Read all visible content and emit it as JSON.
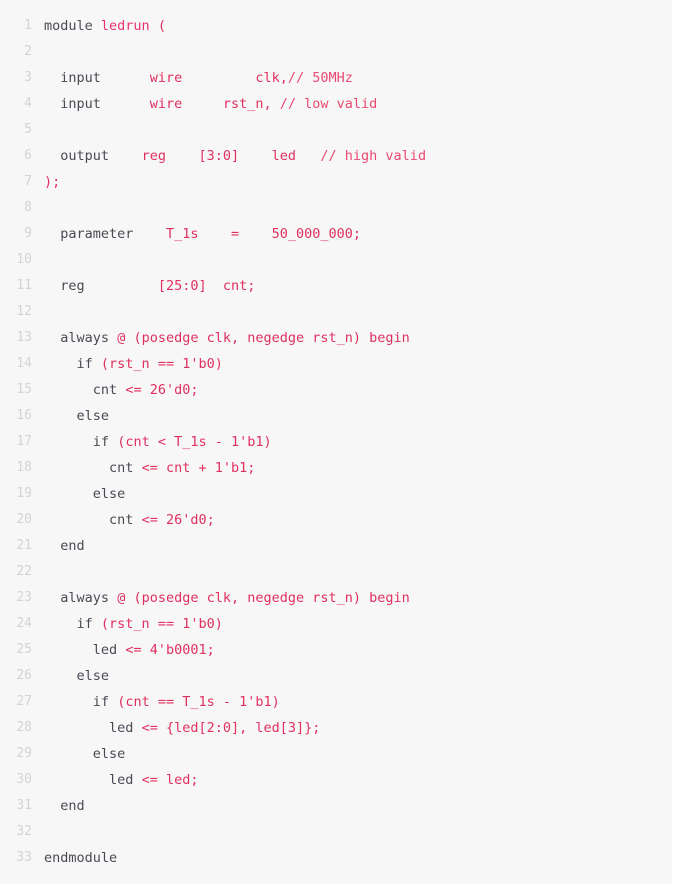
{
  "editor": {
    "language": "verilog",
    "module_name": "ledrun",
    "total_lines": 33,
    "background_color": "#f7f7f7",
    "keyword_color": "#4a4a55",
    "identifier_color": "#e03060",
    "comment_color": "#ea4a72",
    "line_number_color": "#d3d3d8"
  },
  "lines": [
    {
      "number": "1",
      "tokens": [
        {
          "t": "module",
          "c": "kw"
        },
        {
          "t": " ",
          "c": "pl"
        },
        {
          "t": "ledrun",
          "c": "def"
        },
        {
          "t": " ",
          "c": "pl"
        },
        {
          "t": "(",
          "c": "op"
        }
      ]
    },
    {
      "number": "2",
      "tokens": []
    },
    {
      "number": "3",
      "tokens": [
        {
          "t": "  ",
          "c": "pl"
        },
        {
          "t": "input",
          "c": "kw"
        },
        {
          "t": "      ",
          "c": "pl"
        },
        {
          "t": "wire",
          "c": "op"
        },
        {
          "t": "         ",
          "c": "pl"
        },
        {
          "t": "clk,",
          "c": "op"
        },
        {
          "t": "// 50MHz",
          "c": "com"
        }
      ]
    },
    {
      "number": "4",
      "tokens": [
        {
          "t": "  ",
          "c": "pl"
        },
        {
          "t": "input",
          "c": "kw"
        },
        {
          "t": "      ",
          "c": "pl"
        },
        {
          "t": "wire",
          "c": "op"
        },
        {
          "t": "     ",
          "c": "pl"
        },
        {
          "t": "rst_n,",
          "c": "op"
        },
        {
          "t": " ",
          "c": "pl"
        },
        {
          "t": "// low valid",
          "c": "com"
        }
      ]
    },
    {
      "number": "5",
      "tokens": []
    },
    {
      "number": "6",
      "tokens": [
        {
          "t": "  ",
          "c": "pl"
        },
        {
          "t": "output",
          "c": "kw"
        },
        {
          "t": "    ",
          "c": "pl"
        },
        {
          "t": "reg",
          "c": "op"
        },
        {
          "t": "    ",
          "c": "pl"
        },
        {
          "t": "[3:0]",
          "c": "op"
        },
        {
          "t": "    ",
          "c": "pl"
        },
        {
          "t": "led",
          "c": "op"
        },
        {
          "t": "   ",
          "c": "pl"
        },
        {
          "t": "// high valid",
          "c": "com"
        }
      ]
    },
    {
      "number": "7",
      "tokens": [
        {
          "t": ");",
          "c": "op"
        }
      ]
    },
    {
      "number": "8",
      "tokens": []
    },
    {
      "number": "9",
      "tokens": [
        {
          "t": "  ",
          "c": "pl"
        },
        {
          "t": "parameter",
          "c": "kw"
        },
        {
          "t": "    ",
          "c": "pl"
        },
        {
          "t": "T_1s",
          "c": "op"
        },
        {
          "t": "    ",
          "c": "pl"
        },
        {
          "t": "=",
          "c": "op"
        },
        {
          "t": "    ",
          "c": "pl"
        },
        {
          "t": "50_000_000;",
          "c": "num"
        }
      ]
    },
    {
      "number": "10",
      "tokens": []
    },
    {
      "number": "11",
      "tokens": [
        {
          "t": "  ",
          "c": "pl"
        },
        {
          "t": "reg",
          "c": "kw"
        },
        {
          "t": "         ",
          "c": "pl"
        },
        {
          "t": "[25:0]",
          "c": "op"
        },
        {
          "t": "  ",
          "c": "pl"
        },
        {
          "t": "cnt;",
          "c": "op"
        }
      ]
    },
    {
      "number": "12",
      "tokens": []
    },
    {
      "number": "13",
      "tokens": [
        {
          "t": "  ",
          "c": "pl"
        },
        {
          "t": "always",
          "c": "kw"
        },
        {
          "t": " ",
          "c": "pl"
        },
        {
          "t": "@ (posedge clk, negedge rst_n) begin",
          "c": "op"
        }
      ]
    },
    {
      "number": "14",
      "tokens": [
        {
          "t": "    ",
          "c": "pl"
        },
        {
          "t": "if",
          "c": "kw"
        },
        {
          "t": " ",
          "c": "pl"
        },
        {
          "t": "(rst_n == 1'b0)",
          "c": "op"
        }
      ]
    },
    {
      "number": "15",
      "tokens": [
        {
          "t": "      ",
          "c": "pl"
        },
        {
          "t": "cnt",
          "c": "kw"
        },
        {
          "t": " ",
          "c": "pl"
        },
        {
          "t": "<= 26'd0;",
          "c": "op"
        }
      ]
    },
    {
      "number": "16",
      "tokens": [
        {
          "t": "    ",
          "c": "pl"
        },
        {
          "t": "else",
          "c": "kw"
        }
      ]
    },
    {
      "number": "17",
      "tokens": [
        {
          "t": "      ",
          "c": "pl"
        },
        {
          "t": "if",
          "c": "kw"
        },
        {
          "t": " ",
          "c": "pl"
        },
        {
          "t": "(cnt < T_1s - 1'b1)",
          "c": "op"
        }
      ]
    },
    {
      "number": "18",
      "tokens": [
        {
          "t": "        ",
          "c": "pl"
        },
        {
          "t": "cnt",
          "c": "kw"
        },
        {
          "t": " ",
          "c": "pl"
        },
        {
          "t": "<= cnt + 1'b1;",
          "c": "op"
        }
      ]
    },
    {
      "number": "19",
      "tokens": [
        {
          "t": "      ",
          "c": "pl"
        },
        {
          "t": "else",
          "c": "kw"
        }
      ]
    },
    {
      "number": "20",
      "tokens": [
        {
          "t": "        ",
          "c": "pl"
        },
        {
          "t": "cnt",
          "c": "kw"
        },
        {
          "t": " ",
          "c": "pl"
        },
        {
          "t": "<= 26'd0;",
          "c": "op"
        }
      ]
    },
    {
      "number": "21",
      "tokens": [
        {
          "t": "  ",
          "c": "pl"
        },
        {
          "t": "end",
          "c": "kw"
        }
      ]
    },
    {
      "number": "22",
      "tokens": []
    },
    {
      "number": "23",
      "tokens": [
        {
          "t": "  ",
          "c": "pl"
        },
        {
          "t": "always",
          "c": "kw"
        },
        {
          "t": " ",
          "c": "pl"
        },
        {
          "t": "@ (posedge clk, negedge rst_n) begin",
          "c": "op"
        }
      ]
    },
    {
      "number": "24",
      "tokens": [
        {
          "t": "    ",
          "c": "pl"
        },
        {
          "t": "if",
          "c": "kw"
        },
        {
          "t": " ",
          "c": "pl"
        },
        {
          "t": "(rst_n == 1'b0)",
          "c": "op"
        }
      ]
    },
    {
      "number": "25",
      "tokens": [
        {
          "t": "      ",
          "c": "pl"
        },
        {
          "t": "led",
          "c": "kw"
        },
        {
          "t": " ",
          "c": "pl"
        },
        {
          "t": "<= 4'b0001;",
          "c": "op"
        }
      ]
    },
    {
      "number": "26",
      "tokens": [
        {
          "t": "    ",
          "c": "pl"
        },
        {
          "t": "else",
          "c": "kw"
        }
      ]
    },
    {
      "number": "27",
      "tokens": [
        {
          "t": "      ",
          "c": "pl"
        },
        {
          "t": "if",
          "c": "kw"
        },
        {
          "t": " ",
          "c": "pl"
        },
        {
          "t": "(cnt == T_1s - 1'b1)",
          "c": "op"
        }
      ]
    },
    {
      "number": "28",
      "tokens": [
        {
          "t": "        ",
          "c": "pl"
        },
        {
          "t": "led",
          "c": "kw"
        },
        {
          "t": " ",
          "c": "pl"
        },
        {
          "t": "<= {led[2:0], led[3]};",
          "c": "op"
        }
      ]
    },
    {
      "number": "29",
      "tokens": [
        {
          "t": "      ",
          "c": "pl"
        },
        {
          "t": "else",
          "c": "kw"
        }
      ]
    },
    {
      "number": "30",
      "tokens": [
        {
          "t": "        ",
          "c": "pl"
        },
        {
          "t": "led",
          "c": "kw"
        },
        {
          "t": " ",
          "c": "pl"
        },
        {
          "t": "<= led;",
          "c": "op"
        }
      ]
    },
    {
      "number": "31",
      "tokens": [
        {
          "t": "  ",
          "c": "pl"
        },
        {
          "t": "end",
          "c": "kw"
        }
      ]
    },
    {
      "number": "32",
      "tokens": []
    },
    {
      "number": "33",
      "tokens": [
        {
          "t": "endmodule",
          "c": "kw"
        }
      ]
    }
  ]
}
